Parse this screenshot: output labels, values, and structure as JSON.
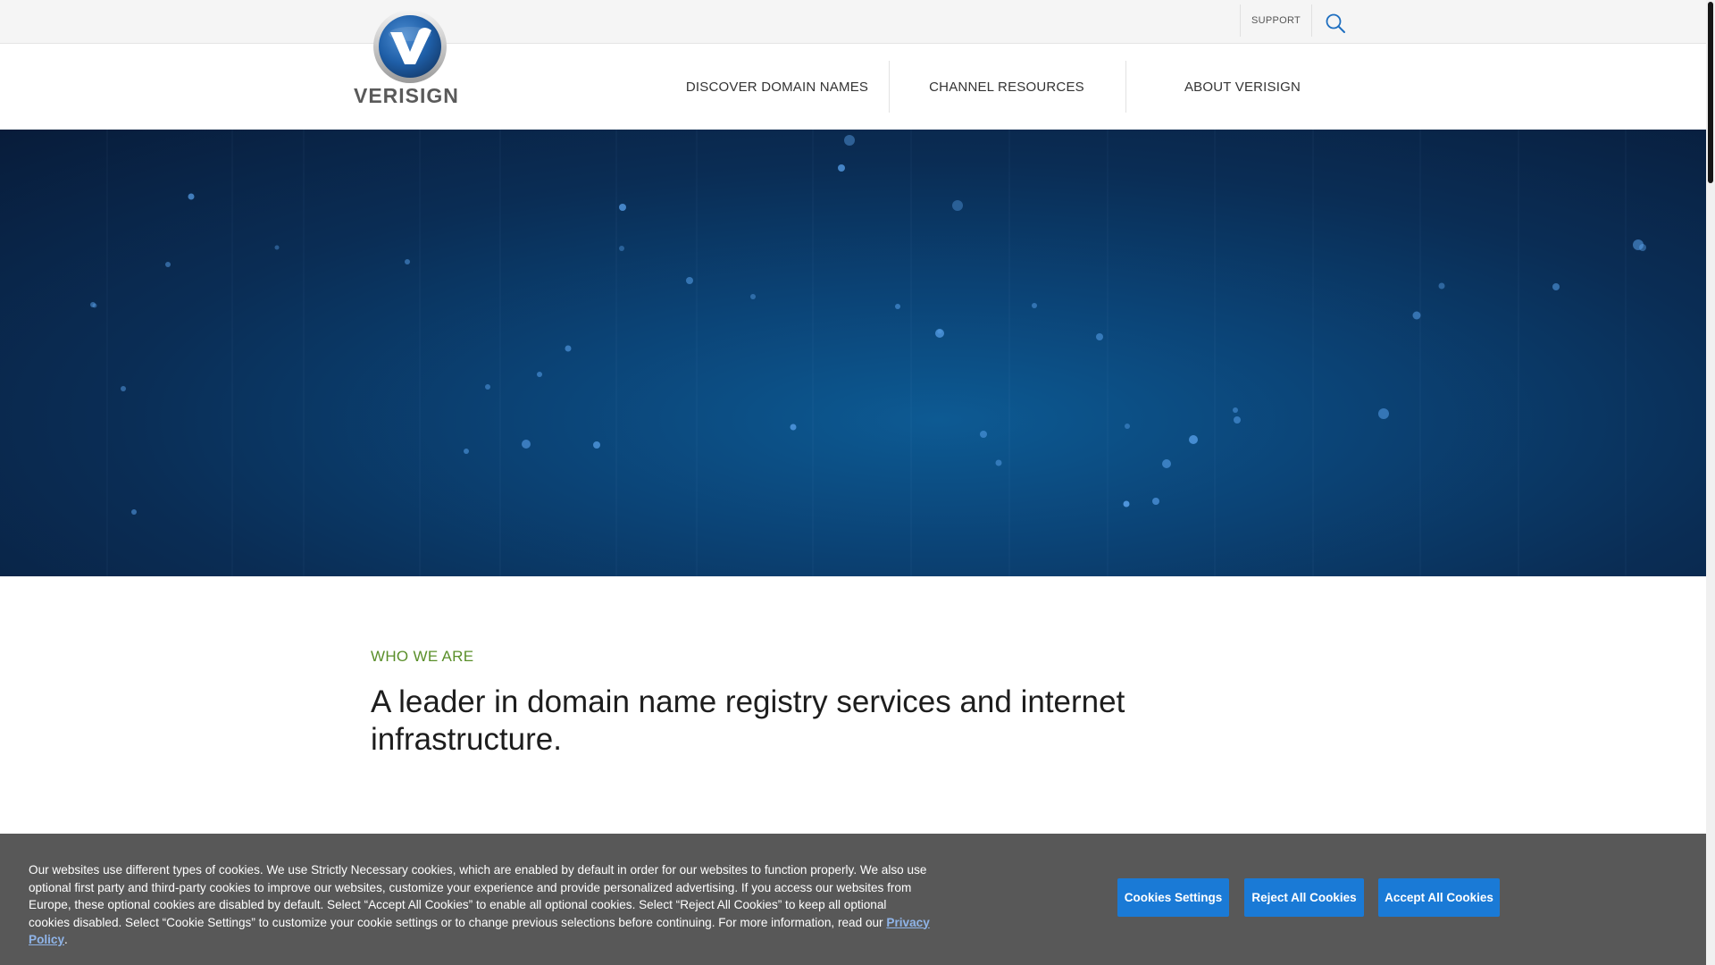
{
  "topbar": {
    "support_label": "SUPPORT",
    "search_icon": "search-icon"
  },
  "brand": {
    "logo_text": "VERISIGN",
    "logo_icon": "verisign-v-icon",
    "colors": {
      "logo_blue": "#1f5fa8",
      "logo_text": "#5a5a5a"
    }
  },
  "nav": {
    "items": [
      {
        "label": "DISCOVER DOMAIN NAMES"
      },
      {
        "label": "CHANNEL RESOURCES"
      },
      {
        "label": "ABOUT VERISIGN"
      }
    ]
  },
  "hero": {
    "colors": {
      "deep": "#081c3a",
      "mid": "#0b4477",
      "glow": "#0d5a93"
    }
  },
  "about": {
    "eyebrow": "WHO WE ARE",
    "headline": "A leader in domain name registry services and internet infrastructure.",
    "eyebrow_color": "#5a8f2a"
  },
  "cookie_banner": {
    "text": "Our websites use different types of cookies. We use Strictly Necessary cookies, which are enabled by default in order for our websites to function properly. We also use optional first party and third-party cookies to improve our websites, customize your experience and provide personalized advertising. If you access our websites from Europe, these optional cookies are disabled by default. Select “Accept All Cookies” to enable all optional cookies. Select “Reject All Cookies” to keep all optional cookies disabled. Select “Cookie Settings” to customize your cookie settings or to change previous selections before continuing. For more information, read our ",
    "privacy_link": "Privacy Policy",
    "trailing": ".",
    "buttons": {
      "settings": "Cookies Settings",
      "reject": "Reject All Cookies",
      "accept": "Accept All Cookies"
    },
    "colors": {
      "background": "#585858",
      "button": "#1a7ad6"
    }
  }
}
